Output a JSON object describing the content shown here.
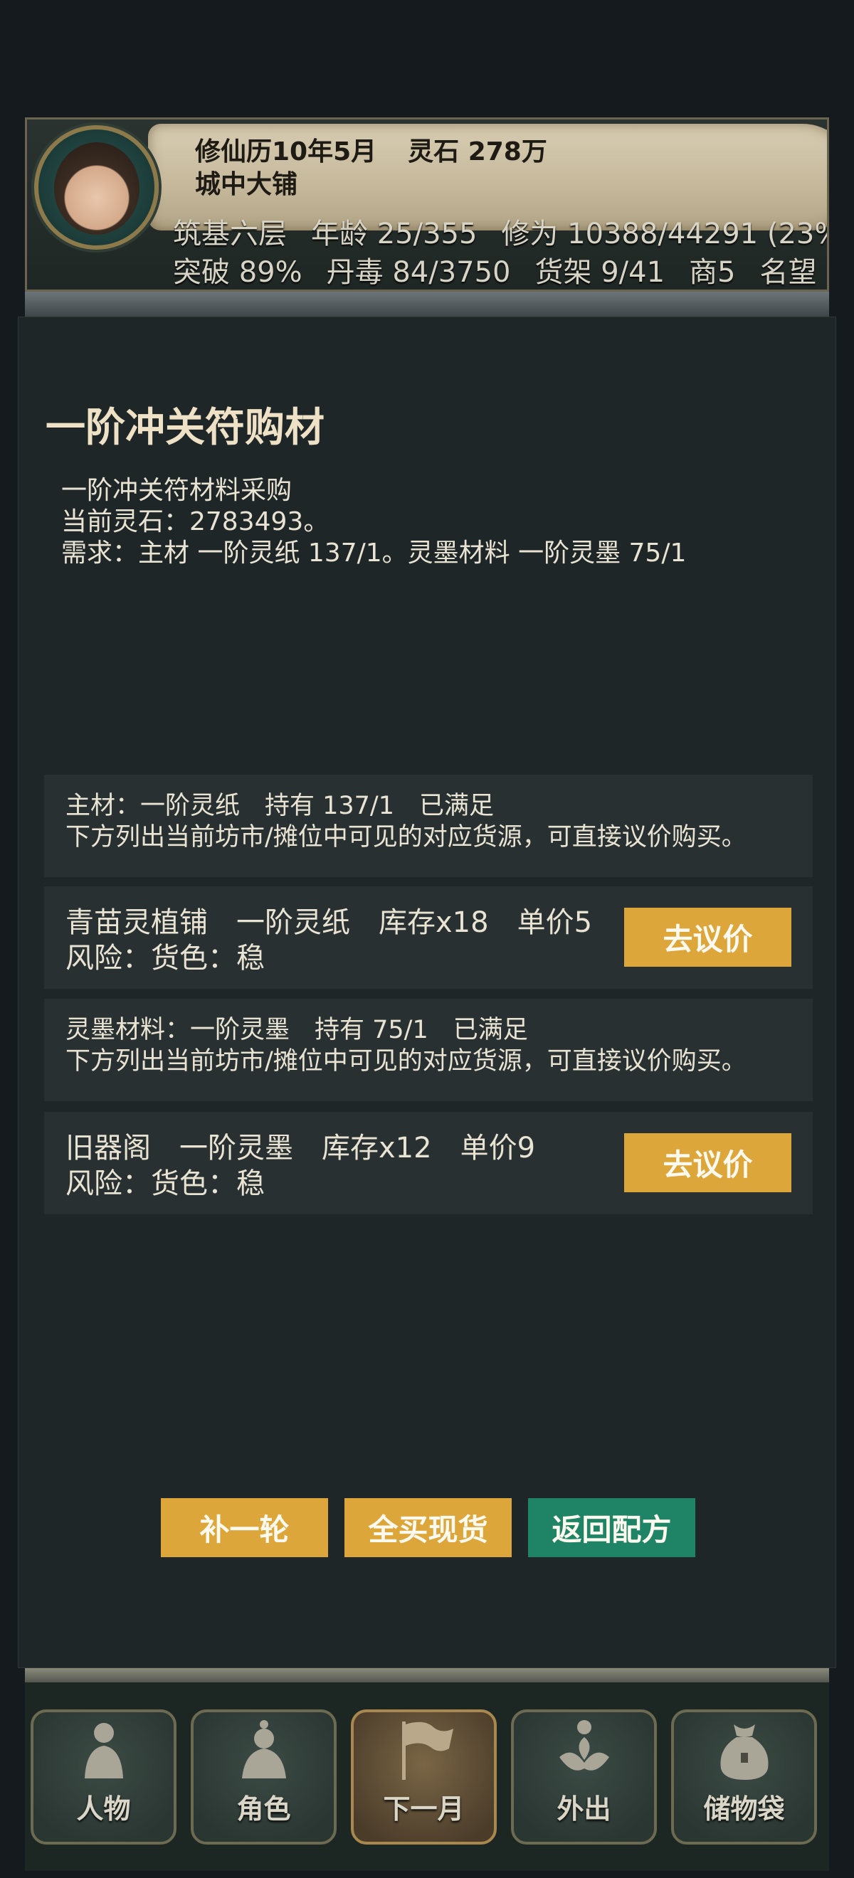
{
  "header": {
    "calendar": "修仙历10年5月",
    "spirit_stones": "灵石 278万",
    "location": "城中大铺",
    "stats_row1": [
      "筑基六层",
      "年龄 25/355",
      "修为 10388/44291 (23%"
    ],
    "stats_row2": [
      "突破 89%",
      "丹毒 84/3750",
      "货架 9/41",
      "商5",
      "名望"
    ]
  },
  "panel": {
    "title": "一阶冲关符购材",
    "desc_lines": [
      "一阶冲关符材料采购",
      "当前灵石：2783493。",
      "需求：主材 一阶灵纸 137/1。灵墨材料 一阶灵墨 75/1"
    ],
    "sections": [
      {
        "info_line1": "主材：一阶灵纸　持有 137/1　已满足",
        "info_line2": "下方列出当前坊市/摊位中可见的对应货源，可直接议价购买。",
        "source": {
          "shop": "青苗灵植铺",
          "item": "一阶灵纸",
          "stock": "库存x18",
          "price": "单价5",
          "risk": "风险：货色：稳",
          "button": "去议价"
        }
      },
      {
        "info_line1": "灵墨材料：一阶灵墨　持有 75/1　已满足",
        "info_line2": "下方列出当前坊市/摊位中可见的对应货源，可直接议价购买。",
        "source": {
          "shop": "旧器阁",
          "item": "一阶灵墨",
          "stock": "库存x12",
          "price": "单价9",
          "risk": "风险：货色：稳",
          "button": "去议价"
        }
      }
    ],
    "actions": {
      "refill": "补一轮",
      "buy_all": "全买现货",
      "back": "返回配方"
    }
  },
  "nav": {
    "items": [
      {
        "label": "人物",
        "icon": "person-icon"
      },
      {
        "label": "角色",
        "icon": "character-icon"
      },
      {
        "label": "下一月",
        "icon": "flag-icon"
      },
      {
        "label": "外出",
        "icon": "lotus-icon"
      },
      {
        "label": "储物袋",
        "icon": "bag-icon"
      }
    ]
  },
  "colors": {
    "gold_button": "#dca63a",
    "teal_button": "#1f8466",
    "panel_bg": "#1f2627"
  }
}
